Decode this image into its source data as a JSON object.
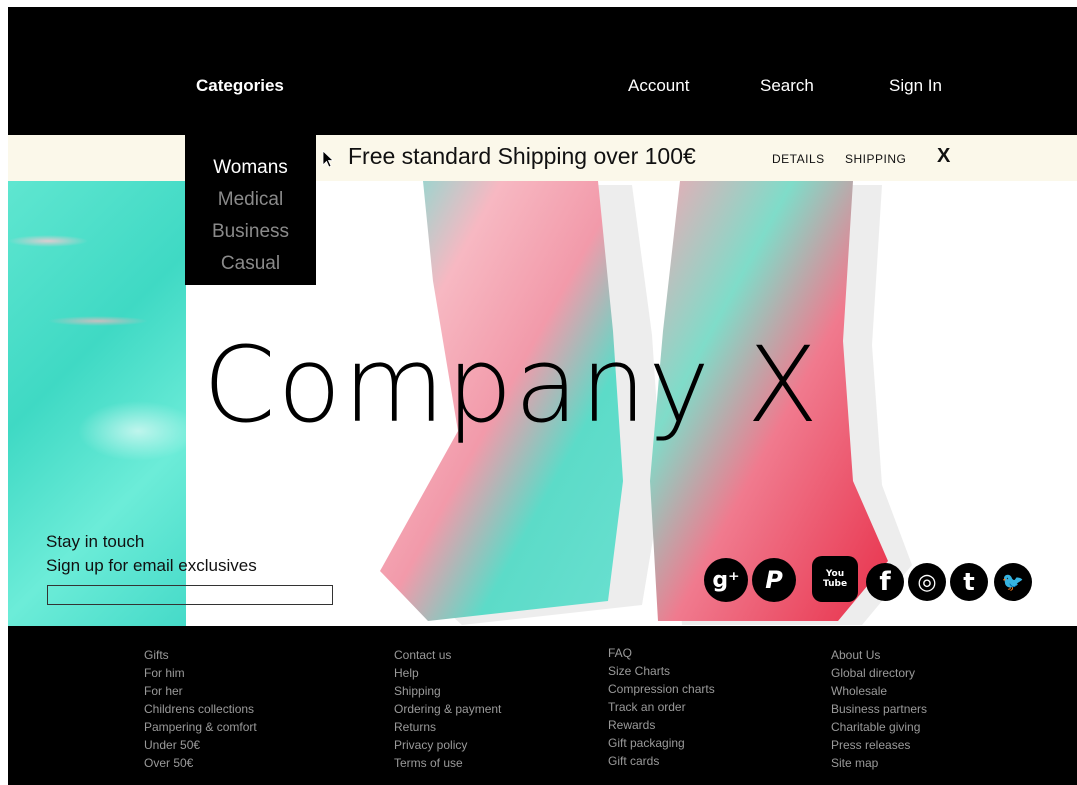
{
  "header": {
    "categories_label": "Categories",
    "account_label": "Account",
    "search_label": "Search",
    "signin_label": "Sign In"
  },
  "categories_menu": {
    "items": [
      "Womans",
      "Medical",
      "Business",
      "Casual"
    ],
    "active": "Womans"
  },
  "banner": {
    "text": "Free standard Shipping over 100€",
    "details_label": "DETAILS",
    "shipping_label": "SHIPPING",
    "close_label": "X"
  },
  "hero": {
    "brand_title": "Company X"
  },
  "newsletter": {
    "line1": "Stay in touch",
    "line2": "Sign up for email exclusives",
    "email_value": "",
    "email_placeholder": ""
  },
  "social": [
    {
      "name": "google-plus-icon",
      "glyph": "g⁺"
    },
    {
      "name": "pinterest-icon",
      "glyph": "P"
    },
    {
      "name": "youtube-icon",
      "glyph": "You\nTube"
    },
    {
      "name": "facebook-icon",
      "glyph": "f"
    },
    {
      "name": "instagram-icon",
      "glyph": "◎"
    },
    {
      "name": "tumblr-icon",
      "glyph": "t"
    },
    {
      "name": "twitter-icon",
      "glyph": "🐦"
    }
  ],
  "footer": {
    "columns": [
      [
        "Gifts",
        "For him",
        "For her",
        "Childrens collections",
        "Pampering & comfort",
        "Under 50€",
        "Over 50€"
      ],
      [
        "Contact us",
        "Help",
        "Shipping",
        "Ordering & payment",
        "Returns",
        "Privacy policy",
        "Terms of use"
      ],
      [
        "FAQ",
        "Size Charts",
        "Compression charts",
        "Track an order",
        "Rewards",
        "Gift packaging",
        "Gift cards"
      ],
      [
        "About Us",
        "Global directory",
        "Wholesale",
        "Business partners",
        "Charitable giving",
        "Press releases",
        "Site map"
      ]
    ]
  },
  "colors": {
    "header_bg": "#000000",
    "banner_bg": "#fbf8ea",
    "teal": "#3fd9c4",
    "pink": "#f5a0b0",
    "red": "#e8304a"
  }
}
